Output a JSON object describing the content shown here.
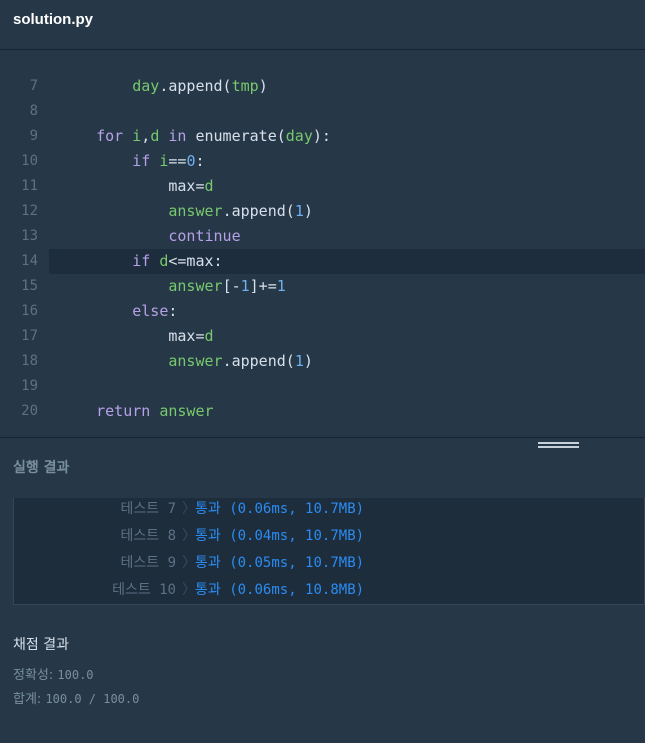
{
  "header": {
    "file_name": "solution.py"
  },
  "editor": {
    "lines": [
      {
        "n": "7",
        "tokens": [
          [
            "ind",
            "        "
          ],
          [
            "var",
            "day"
          ],
          [
            "fn",
            ".append("
          ],
          [
            "var",
            "tmp"
          ],
          [
            "fn",
            ")"
          ]
        ]
      },
      {
        "n": "8",
        "tokens": []
      },
      {
        "n": "9",
        "tokens": [
          [
            "ind",
            "    "
          ],
          [
            "kw",
            "for "
          ],
          [
            "var",
            "i"
          ],
          [
            "fn",
            ","
          ],
          [
            "var",
            "d"
          ],
          [
            "kw",
            " in "
          ],
          [
            "fn",
            "enumerate("
          ],
          [
            "var",
            "day"
          ],
          [
            "fn",
            "):"
          ]
        ]
      },
      {
        "n": "10",
        "tokens": [
          [
            "ind",
            "        "
          ],
          [
            "kw",
            "if "
          ],
          [
            "var",
            "i"
          ],
          [
            "fn",
            "=="
          ],
          [
            "num",
            "0"
          ],
          [
            "fn",
            ":"
          ]
        ]
      },
      {
        "n": "11",
        "tokens": [
          [
            "ind",
            "            "
          ],
          [
            "fn",
            "max="
          ],
          [
            "var",
            "d"
          ]
        ]
      },
      {
        "n": "12",
        "tokens": [
          [
            "ind",
            "            "
          ],
          [
            "var",
            "answer"
          ],
          [
            "fn",
            ".append("
          ],
          [
            "num",
            "1"
          ],
          [
            "fn",
            ")"
          ]
        ]
      },
      {
        "n": "13",
        "tokens": [
          [
            "ind",
            "            "
          ],
          [
            "kw",
            "continue"
          ]
        ]
      },
      {
        "n": "14",
        "tokens": [
          [
            "ind",
            "        "
          ],
          [
            "kw",
            "if "
          ],
          [
            "var",
            "d"
          ],
          [
            "fn",
            "<=max:"
          ]
        ]
      },
      {
        "n": "15",
        "tokens": [
          [
            "ind",
            "            "
          ],
          [
            "var",
            "answer"
          ],
          [
            "fn",
            "[-"
          ],
          [
            "num",
            "1"
          ],
          [
            "fn",
            "]+="
          ],
          [
            "num",
            "1"
          ]
        ]
      },
      {
        "n": "16",
        "tokens": [
          [
            "ind",
            "        "
          ],
          [
            "kw",
            "else"
          ],
          [
            "fn",
            ":"
          ]
        ]
      },
      {
        "n": "17",
        "tokens": [
          [
            "ind",
            "            "
          ],
          [
            "fn",
            "max="
          ],
          [
            "var",
            "d"
          ]
        ]
      },
      {
        "n": "18",
        "tokens": [
          [
            "ind",
            "            "
          ],
          [
            "var",
            "answer"
          ],
          [
            "fn",
            ".append("
          ],
          [
            "num",
            "1"
          ],
          [
            "fn",
            ")"
          ]
        ]
      },
      {
        "n": "19",
        "tokens": []
      },
      {
        "n": "20",
        "tokens": [
          [
            "ind",
            "    "
          ],
          [
            "kw",
            "return "
          ],
          [
            "var",
            "answer"
          ]
        ]
      }
    ],
    "active_line": "14"
  },
  "results": {
    "title": "실행 결과",
    "rows": [
      {
        "name": "테스트 7",
        "result": "통과 (0.06ms, 10.7MB)"
      },
      {
        "name": "테스트 8",
        "result": "통과 (0.04ms, 10.7MB)"
      },
      {
        "name": "테스트 9",
        "result": "통과 (0.05ms, 10.7MB)"
      },
      {
        "name": "테스트 10",
        "result": "통과 (0.06ms, 10.8MB)"
      }
    ]
  },
  "grading": {
    "title": "채점 결과",
    "accuracy_label": "정확성: ",
    "accuracy_value": "100.0",
    "total_label": "합계: ",
    "total_value": "100.0 / 100.0"
  },
  "colors": {
    "background": "#263747",
    "keyword": "#b7a1e6",
    "variable": "#78c96d",
    "number": "#6fb0f0",
    "pass": "#2a8cf2"
  }
}
